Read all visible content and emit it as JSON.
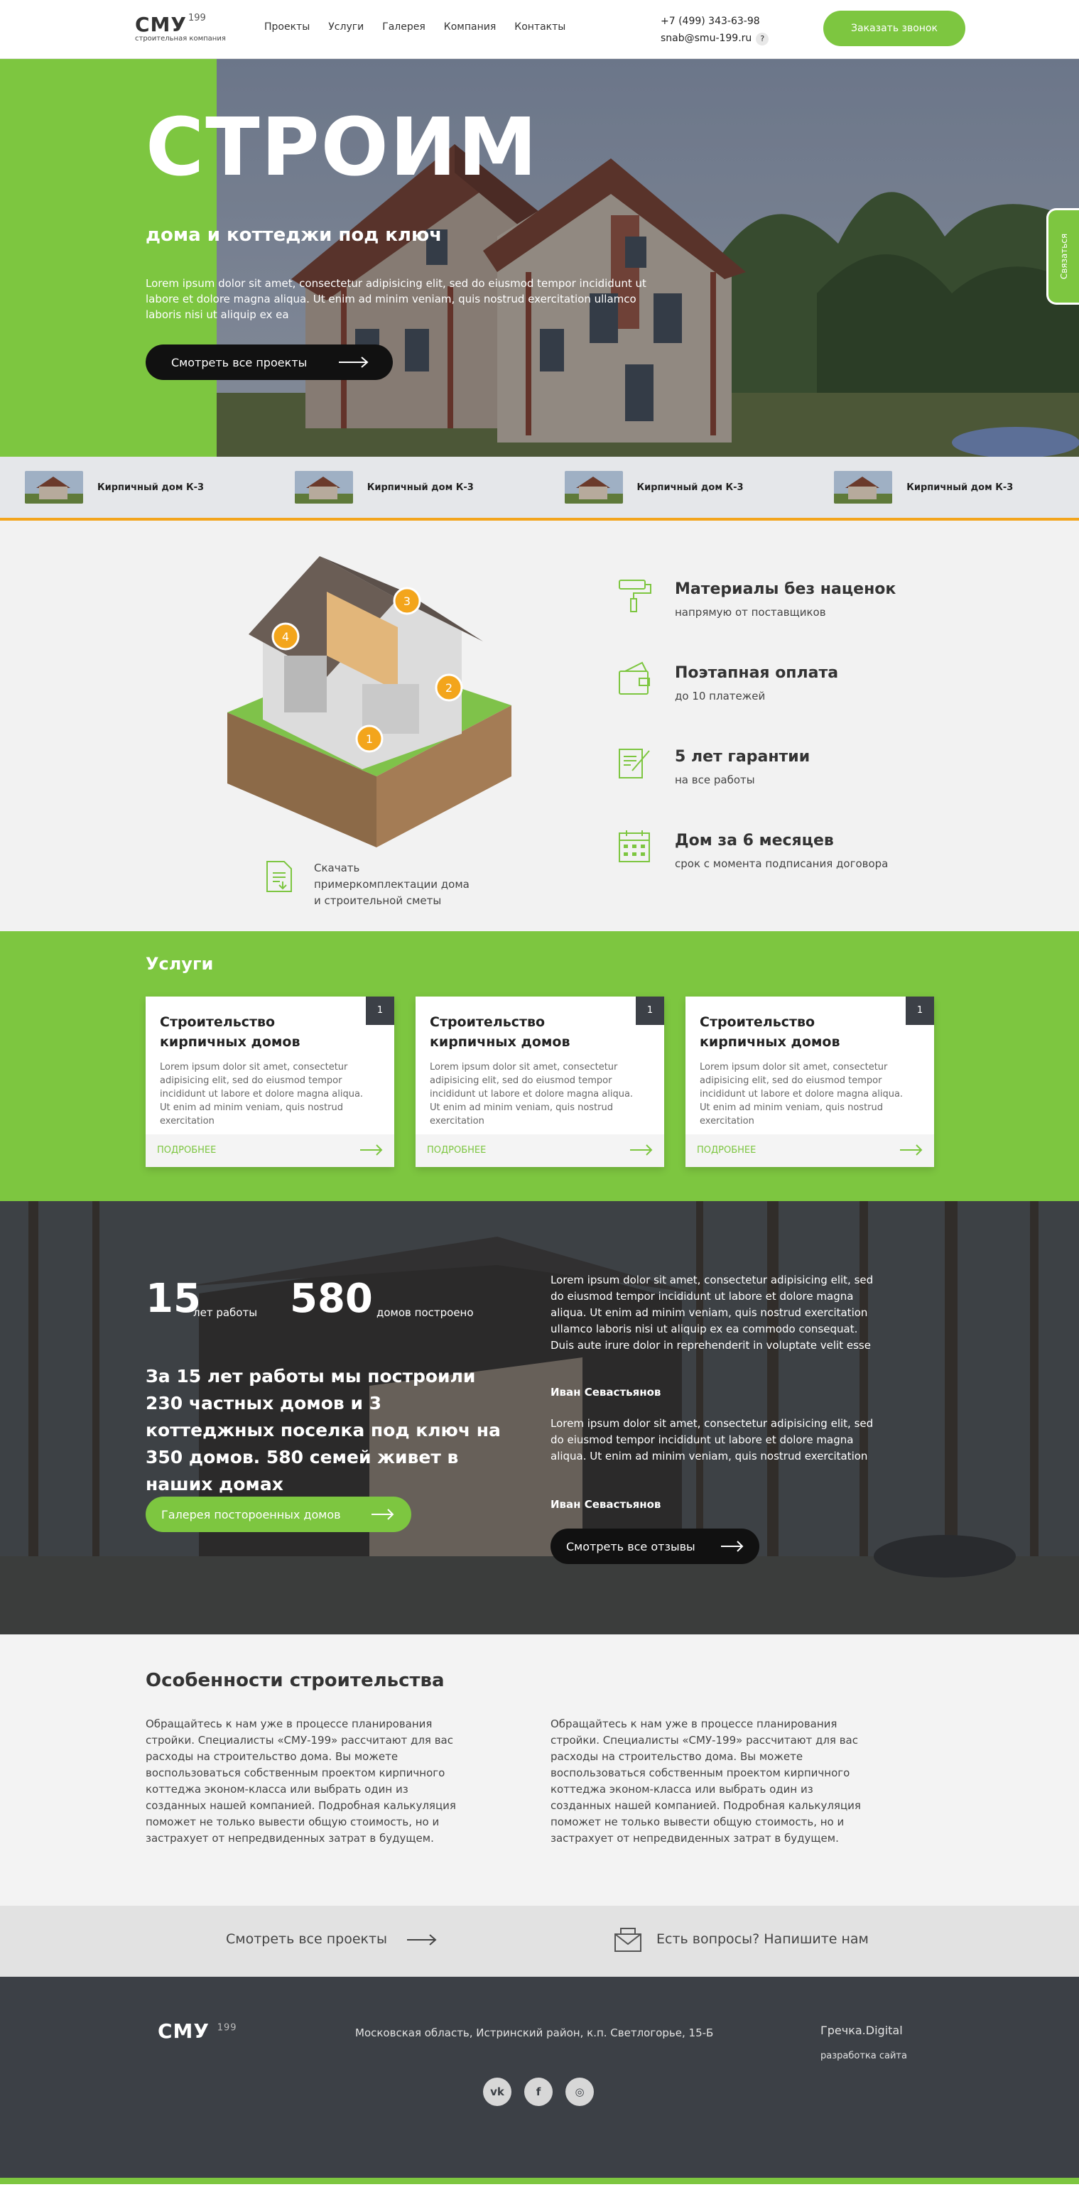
{
  "header": {
    "logo": "СМУ",
    "logo_sup": "199",
    "logo_sub": "строительная компания",
    "nav": [
      "Проекты",
      "Услуги",
      "Галерея",
      "Компания",
      "Контакты"
    ],
    "phone": "+7 (499) 343-63-98",
    "email": "snab@smu-199.ru",
    "help": "?",
    "call_button": "Заказать звонок"
  },
  "hero": {
    "title": "СТРОИМ",
    "subtitle": "дома и коттеджи под ключ",
    "text": "Lorem ipsum dolor sit amet, consectetur adipisicing elit, sed do eiusmod tempor incididunt ut labore et dolore magna aliqua. Ut enim ad minim veniam, quis nostrud exercitation ullamco laboris nisi ut aliquip ex ea",
    "button": "Смотреть все проекты",
    "side_tab": "Связаться"
  },
  "projects": [
    {
      "label": "Кирпичный дом К-3"
    },
    {
      "label": "Кирпичный дом К-3"
    },
    {
      "label": "Кирпичный дом К-3"
    },
    {
      "label": "Кирпичный дом К-3"
    }
  ],
  "features": {
    "house_markers": [
      "1",
      "2",
      "3",
      "4"
    ],
    "download_text": "Скачать пример",
    "download_text2": "комплектации дома и строительной сметы",
    "items": [
      {
        "title": "Материалы без наценок",
        "sub": "напрямую от поставщиков",
        "icon": "paint-roller-icon"
      },
      {
        "title": "Поэтапная оплата",
        "sub": "до 10 платежей",
        "icon": "wallet-icon"
      },
      {
        "title": "5 лет гарантии",
        "sub": "на все работы",
        "icon": "contract-icon"
      },
      {
        "title": "Дом за 6 месяцев",
        "sub": "срок с момента подписания договора",
        "icon": "calendar-icon"
      }
    ]
  },
  "services": {
    "title": "Услуги",
    "cards": [
      {
        "num": "1",
        "title": "Строительство кирпичных домов",
        "text": "Lorem ipsum dolor sit amet, consectetur adipisicing elit, sed do eiusmod tempor incididunt ut labore et dolore magna aliqua. Ut enim ad minim veniam, quis nostrud exercitation",
        "more": "ПОДРОБНЕЕ"
      },
      {
        "num": "1",
        "title": "Строительство кирпичных домов",
        "text": "Lorem ipsum dolor sit amet, consectetur adipisicing elit, sed do eiusmod tempor incididunt ut labore et dolore magna aliqua. Ut enim ad minim veniam, quis nostrud exercitation",
        "more": "ПОДРОБНЕЕ"
      },
      {
        "num": "1",
        "title": "Строительство кирпичных домов",
        "text": "Lorem ipsum dolor sit amet, consectetur adipisicing elit, sed do eiusmod tempor incididunt ut labore et dolore magna aliqua. Ut enim ad minim veniam, quis nostrud exercitation",
        "more": "ПОДРОБНЕЕ"
      }
    ]
  },
  "stats": {
    "years_num": "15",
    "years_label": "лет работы",
    "houses_num": "580",
    "houses_label": "домов построено",
    "headline": "За 15 лет работы мы построили 230 частных домов и 3 коттеджных поселка под ключ на 350 домов. 580 семей живет в наших домах",
    "gallery_button": "Галерея постороенных домов",
    "reviews": [
      {
        "text": "Lorem ipsum dolor sit amet, consectetur adipisicing elit, sed do eiusmod tempor incididunt ut labore et dolore magna aliqua. Ut enim ad minim veniam, quis nostrud exercitation ullamco laboris nisi ut aliquip ex ea commodo consequat. Duis aute irure dolor in reprehenderit in voluptate velit esse",
        "author": "Иван Севастьянов"
      },
      {
        "text": "Lorem ipsum dolor sit amet, consectetur adipisicing elit, sed do eiusmod tempor incididunt ut labore et dolore magna aliqua. Ut enim ad minim veniam, quis nostrud exercitation",
        "author": "Иван Севастьянов"
      }
    ],
    "reviews_button": "Смотреть все отзывы"
  },
  "peculiar": {
    "title": "Особенности строительства",
    "col1": "Обращайтесь к нам уже в процессе планирования стройки. Специалисты «СМУ-199» рассчитают для вас расходы на строительство дома. Вы можете воспользоваться собственным проектом кирпичного коттеджа эконом-класса или выбрать один из созданных нашей компанией. Подробная калькуляция поможет не только вывести общую стоимость, но и застрахует от непредвиденных затрат в будущем.",
    "col2": "Обращайтесь к нам уже в процессе планирования стройки. Специалисты «СМУ-199» рассчитают для вас расходы на строительство дома. Вы можете воспользоваться собственным проектом кирпичного коттеджа эконом-класса или выбрать один из созданных нашей компанией. Подробная калькуляция поможет не только вывести общую стоимость, но и застрахует от непредвиденных затрат в будущем."
  },
  "cta": {
    "projects": "Смотреть все проекты",
    "question": "Есть вопросы? Напишите нам"
  },
  "footer": {
    "logo": "СМУ",
    "logo_sup": "199",
    "address": "Московская область, Истринский район, к.п. Светлогорье, 15-Б",
    "dev": "Гречка.Digital",
    "dev_sub": "разработка сайта",
    "socials": [
      "vk-icon",
      "facebook-icon",
      "instagram-icon"
    ],
    "social_labels": [
      "vk",
      "f",
      "◎"
    ]
  },
  "colors": {
    "accent": "#7dc640",
    "dark": "#3c4046",
    "orange": "#f3a51c"
  }
}
